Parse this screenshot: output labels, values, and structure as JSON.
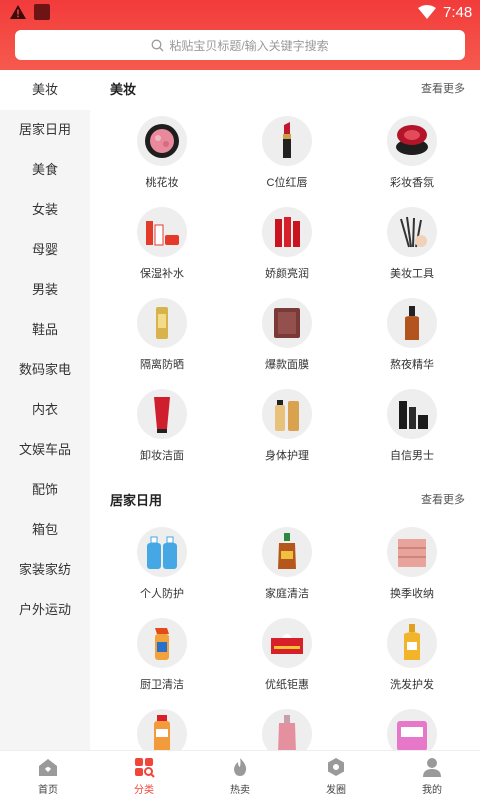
{
  "status": {
    "time": "7:48",
    "icons": [
      "alert-icon",
      "app-icon",
      "wifi-icon"
    ]
  },
  "search": {
    "placeholder": "粘贴宝贝标题/输入关键字搜索",
    "icon": "search-icon"
  },
  "sidebar": {
    "active_index": 0,
    "items": [
      {
        "label": "美妆"
      },
      {
        "label": "居家日用"
      },
      {
        "label": "美食"
      },
      {
        "label": "女装"
      },
      {
        "label": "母婴"
      },
      {
        "label": "男装"
      },
      {
        "label": "鞋品"
      },
      {
        "label": "数码家电"
      },
      {
        "label": "内衣"
      },
      {
        "label": "文娱车品"
      },
      {
        "label": "配饰"
      },
      {
        "label": "箱包"
      },
      {
        "label": "家装家纺"
      },
      {
        "label": "户外运动"
      }
    ]
  },
  "sections": [
    {
      "title": "美妆",
      "more": "查看更多",
      "items": [
        {
          "label": "桃花妆",
          "icon": "blush-compact-icon"
        },
        {
          "label": "C位红唇",
          "icon": "lipstick-icon"
        },
        {
          "label": "彩妆香氛",
          "icon": "cushion-compact-icon"
        },
        {
          "label": "保湿补水",
          "icon": "skincare-set-icon"
        },
        {
          "label": "娇颜亮润",
          "icon": "serum-bottles-icon"
        },
        {
          "label": "美妆工具",
          "icon": "makeup-brushes-icon"
        },
        {
          "label": "隔离防晒",
          "icon": "sunscreen-icon"
        },
        {
          "label": "爆款面膜",
          "icon": "face-mask-icon"
        },
        {
          "label": "熬夜精华",
          "icon": "essence-bottle-icon"
        },
        {
          "label": "卸妆洁面",
          "icon": "cleanser-tube-icon"
        },
        {
          "label": "身体护理",
          "icon": "body-lotion-icon"
        },
        {
          "label": "自信男士",
          "icon": "mens-care-icon"
        }
      ]
    },
    {
      "title": "居家日用",
      "more": "查看更多",
      "items": [
        {
          "label": "个人防护",
          "icon": "sanitizer-icon"
        },
        {
          "label": "家庭清洁",
          "icon": "disinfectant-icon"
        },
        {
          "label": "换季收纳",
          "icon": "storage-box-icon"
        },
        {
          "label": "厨卫清洁",
          "icon": "spray-cleaner-icon"
        },
        {
          "label": "优纸钜惠",
          "icon": "tissue-box-icon"
        },
        {
          "label": "洗发护发",
          "icon": "shampoo-icon"
        },
        {
          "label": "",
          "icon": "mouthwash-icon"
        },
        {
          "label": "",
          "icon": "perfume-icon"
        },
        {
          "label": "",
          "icon": "pad-pack-icon"
        }
      ]
    }
  ],
  "tabbar": {
    "active_index": 1,
    "items": [
      {
        "label": "首页",
        "icon": "home-icon"
      },
      {
        "label": "分类",
        "icon": "category-icon"
      },
      {
        "label": "热卖",
        "icon": "hot-icon"
      },
      {
        "label": "发圈",
        "icon": "moments-icon"
      },
      {
        "label": "我的",
        "icon": "profile-icon"
      }
    ]
  },
  "colors": {
    "brand": "#f23b3b",
    "active_tab": "#f2453a",
    "sidebar_bg": "#f5f5f5"
  }
}
